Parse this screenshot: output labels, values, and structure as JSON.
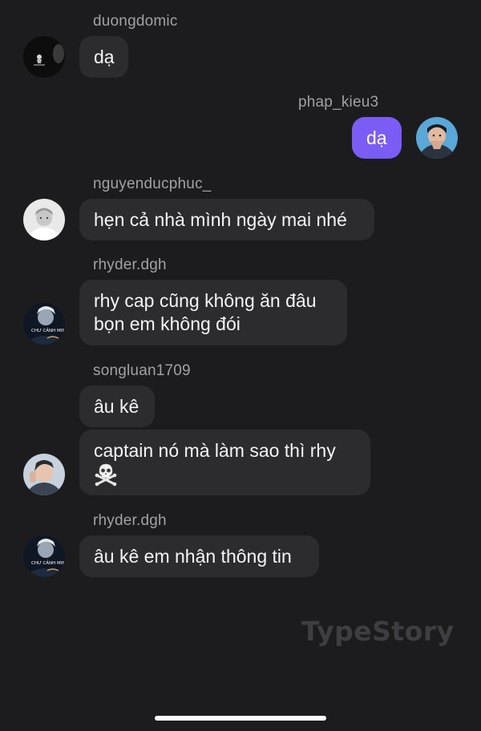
{
  "messages": [
    {
      "username": "duongdomic",
      "texts": [
        "dạ"
      ]
    },
    {
      "username": "phap_kieu3",
      "texts": [
        "dạ"
      ]
    },
    {
      "username": "nguyenducphuc_",
      "texts": [
        "hẹn cả nhà mình ngày mai nhé"
      ]
    },
    {
      "username": "rhyder.dgh",
      "texts": [
        "rhy cap cũng không ăn đâu",
        "bọn em không đói"
      ]
    },
    {
      "username": "songluan1709",
      "texts": [
        "âu kê",
        "captain nó mà làm sao thì rhy"
      ]
    },
    {
      "username": "rhyder.dgh",
      "texts": [
        "âu kê em nhận thông tin"
      ]
    }
  ],
  "avatar_texts": {
    "rhyder": "CHƯ CẢNH MINH"
  },
  "icons": {
    "skull": "skull-and-crossbones-icon"
  },
  "watermark": "TypeStory",
  "colors": {
    "background": "#1c1c1e",
    "bubble_other": "#2c2c2e",
    "bubble_mine": "#7b5cf5",
    "username": "#a1a1a6"
  }
}
